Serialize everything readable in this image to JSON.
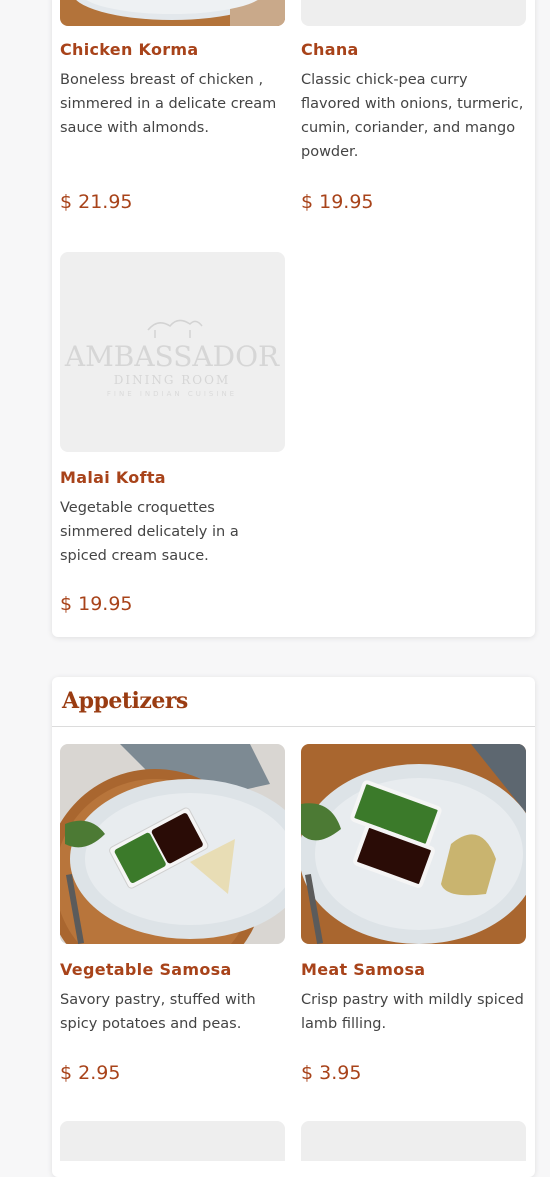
{
  "sections": {
    "mains": {
      "items": [
        {
          "name": "Chicken Korma",
          "desc": "Boneless breast of chicken , simmered in a delicate cream sauce with almonds.",
          "price": "$ 21.95"
        },
        {
          "name": "Chana",
          "desc": "Classic chick-pea curry flavored with onions, turmeric, cumin, coriander, and mango powder.",
          "price": "$ 19.95"
        },
        {
          "name": "Malai Kofta",
          "desc": "Vegetable croquettes simmered delicately in a spiced cream sauce.",
          "price": "$ 19.95"
        }
      ],
      "placeholder_logo": {
        "title": "AMBASSADOR",
        "subtitle": "DINING ROOM",
        "tagline": "FINE INDIAN CUISINE"
      }
    },
    "appetizers": {
      "title": "Appetizers",
      "items": [
        {
          "name": "Vegetable Samosa",
          "desc": "Savory pastry, stuffed with spicy potatoes and peas.",
          "price": "$ 2.95"
        },
        {
          "name": "Meat Samosa",
          "desc": "Crisp pastry with mildly spiced lamb filling.",
          "price": "$ 3.95"
        }
      ]
    }
  },
  "colors": {
    "accent": "#a8431a",
    "heading": "#9a3c12",
    "placeholder_bg": "#efefef"
  }
}
